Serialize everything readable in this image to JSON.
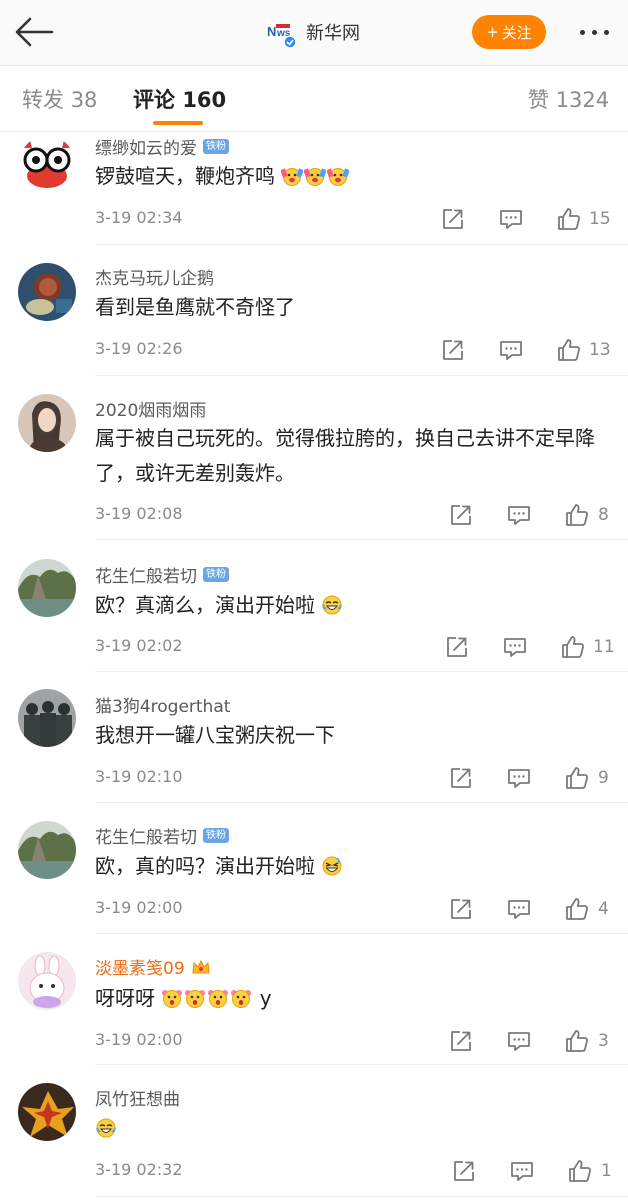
{
  "header": {
    "account_name": "新华网",
    "follow_label": "关注",
    "follow_plus": "+",
    "accent_color": "#ff8200"
  },
  "tabs": [
    {
      "label": "转发",
      "count": "38"
    },
    {
      "label": "评论",
      "count": "160"
    },
    {
      "label": "赞",
      "count": "1324"
    }
  ],
  "comments": [
    {
      "user": "缥缈如云的爱",
      "badge": "铁粉",
      "text": "锣鼓喧天，鞭炮齐鸣",
      "time": "3-19 02:34",
      "likes": "15",
      "avatar_icon": "red-crab-cartoon"
    },
    {
      "user": "杰克马玩儿企鹅",
      "badge": "",
      "text": "看到是鱼鹰就不奇怪了",
      "time": "3-19 02:26",
      "likes": "13",
      "avatar_icon": "food-photo"
    },
    {
      "user": "2020烟雨烟雨",
      "badge": "",
      "text": "属于被自己玩死的。觉得俄拉胯的，换自己去讲不定早降了，或许无差别轰炸。",
      "time": "3-19 02:08",
      "likes": "8",
      "avatar_icon": "woman-portrait"
    },
    {
      "user": "花生仁般若切",
      "badge": "铁粉",
      "text": "欧？真滴么，演出开始啦",
      "time": "3-19 02:02",
      "likes": "11",
      "avatar_icon": "landscape-photo"
    },
    {
      "user": "猫3狗4rogerthat",
      "badge": "",
      "text": "我想开一罐八宝粥庆祝一下",
      "time": "3-19 02:10",
      "likes": "9",
      "avatar_icon": "soldiers-photo"
    },
    {
      "user": "花生仁般若切",
      "badge": "铁粉",
      "text": "欧，真的吗？演出开始啦",
      "time": "3-19 02:00",
      "likes": "4",
      "avatar_icon": "landscape-photo"
    },
    {
      "user": "淡墨素笺09",
      "badge": "",
      "text": "呀呀呀",
      "text_suffix": "y",
      "time": "3-19 02:00",
      "likes": "3",
      "avatar_icon": "bunny-cartoon"
    },
    {
      "user": "凤竹狂想曲",
      "badge": "",
      "text": "",
      "time": "3-19 02:32",
      "likes": "1",
      "avatar_icon": "autumn-leaves-photo"
    }
  ]
}
